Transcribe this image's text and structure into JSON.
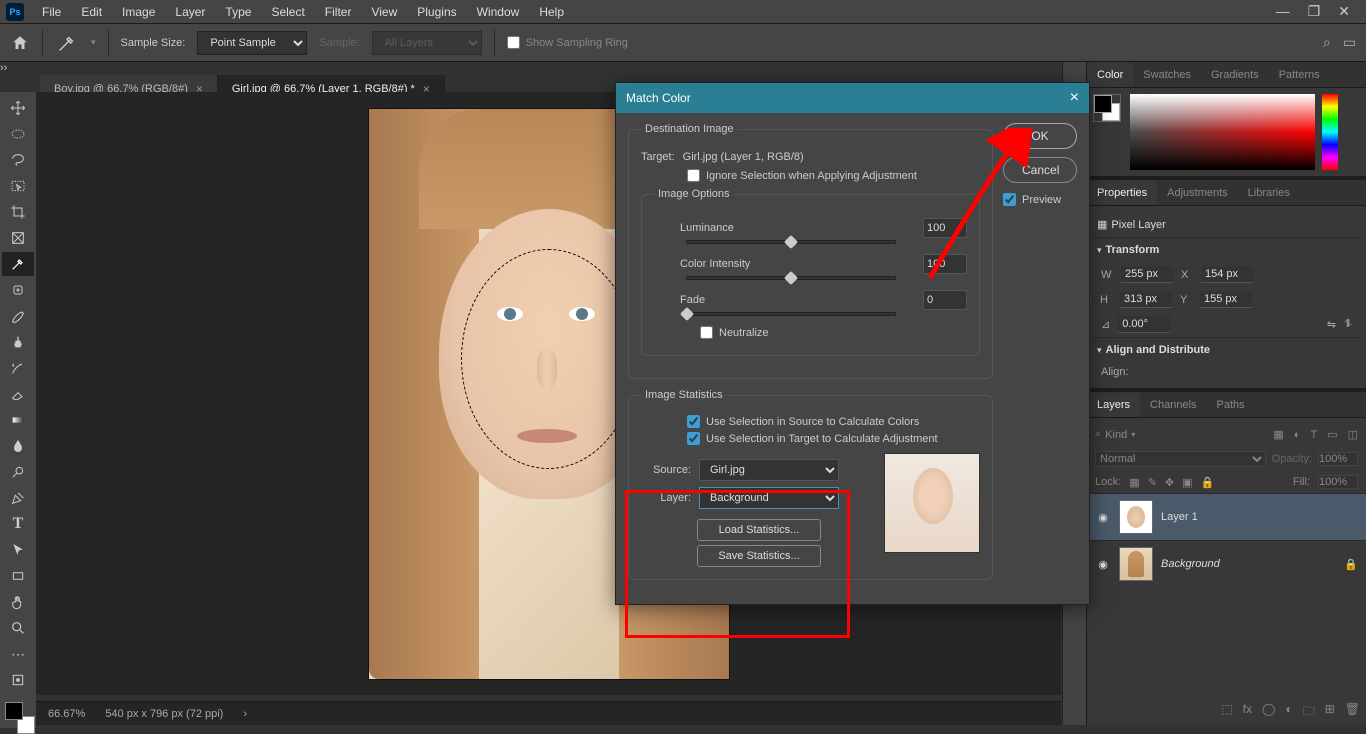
{
  "menubar": {
    "items": [
      "File",
      "Edit",
      "Image",
      "Layer",
      "Type",
      "Select",
      "Filter",
      "View",
      "Plugins",
      "Window",
      "Help"
    ]
  },
  "options_bar": {
    "sample_size_label": "Sample Size:",
    "sample_size_value": "Point Sample",
    "sample_label": "Sample:",
    "sample_value": "All Layers",
    "show_sampling_ring": "Show Sampling Ring"
  },
  "tabs": [
    {
      "label": "Boy.jpg @ 66.7% (RGB/8#)",
      "active": false
    },
    {
      "label": "Girl.jpg @ 66.7% (Layer 1, RGB/8#) *",
      "active": true
    }
  ],
  "dialog": {
    "title": "Match Color",
    "ok": "OK",
    "cancel": "Cancel",
    "preview_check": "Preview",
    "dest_legend": "Destination Image",
    "target_label": "Target:",
    "target_value": "Girl.jpg (Layer 1, RGB/8)",
    "ignore_selection": "Ignore Selection when Applying Adjustment",
    "image_options": "Image Options",
    "luminance_label": "Luminance",
    "luminance_value": "100",
    "color_intensity_label": "Color Intensity",
    "color_intensity_value": "100",
    "fade_label": "Fade",
    "fade_value": "0",
    "neutralize": "Neutralize",
    "stats_legend": "Image Statistics",
    "use_sel_source": "Use Selection in Source to Calculate Colors",
    "use_sel_target": "Use Selection in Target to Calculate Adjustment",
    "source_label": "Source:",
    "source_value": "Girl.jpg",
    "layer_label": "Layer:",
    "layer_value": "Background",
    "load_stats": "Load Statistics...",
    "save_stats": "Save Statistics..."
  },
  "right": {
    "color_tabs": [
      "Color",
      "Swatches",
      "Gradients",
      "Patterns"
    ],
    "props_tabs": [
      "Properties",
      "Adjustments",
      "Libraries"
    ],
    "pixel_layer": "Pixel Layer",
    "transform": "Transform",
    "align": "Align and Distribute",
    "align_label": "Align:",
    "w_label": "W",
    "w_val": "255 px",
    "x_label": "X",
    "x_val": "154 px",
    "h_label": "H",
    "h_val": "313 px",
    "y_label": "Y",
    "y_val": "155 px",
    "angle": "0.00°",
    "layers_tabs": [
      "Layers",
      "Channels",
      "Paths"
    ],
    "kind_label": "Kind",
    "blend_mode": "Normal",
    "opacity_label": "Opacity:",
    "opacity_value": "100%",
    "lock_label": "Lock:",
    "fill_label": "Fill:",
    "fill_value": "100%",
    "layers": [
      {
        "name": "Layer 1",
        "italic": false,
        "active": true,
        "locked": false
      },
      {
        "name": "Background",
        "italic": true,
        "active": false,
        "locked": true
      }
    ]
  },
  "status": {
    "zoom": "66.67%",
    "dims": "540 px x 796 px (72 ppi)"
  }
}
